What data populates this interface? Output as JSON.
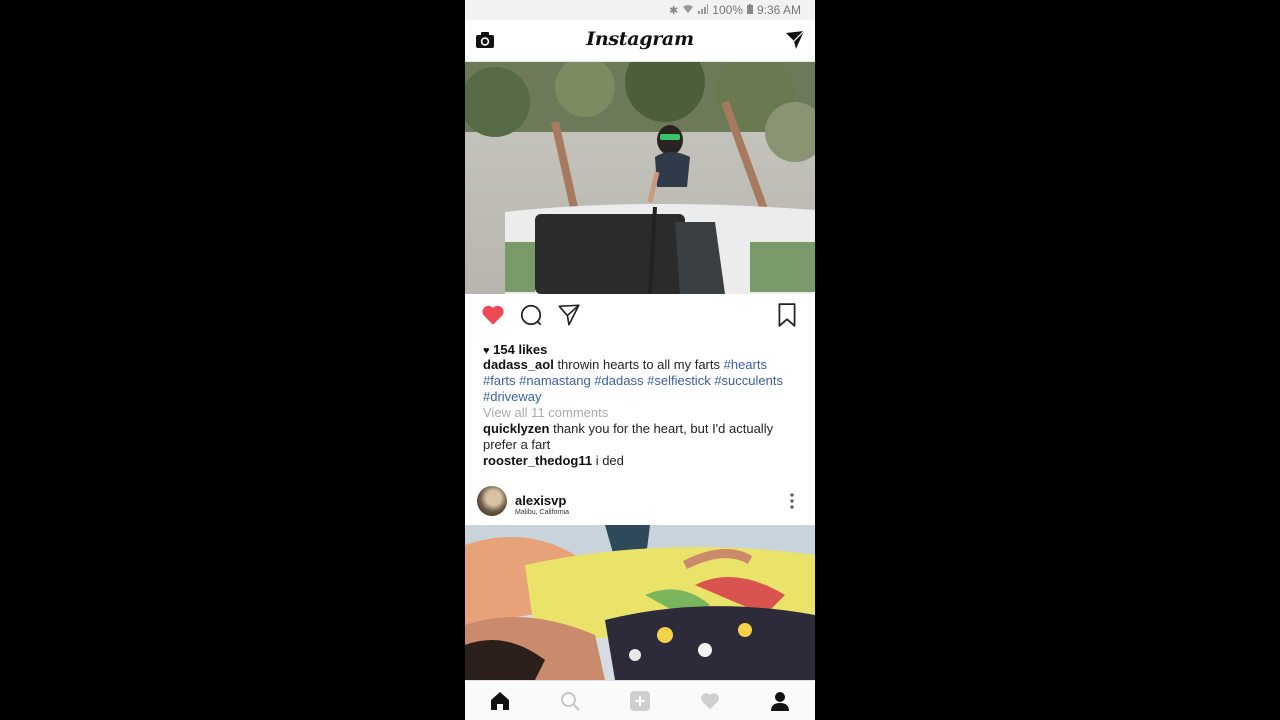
{
  "status_bar": {
    "battery": "100%",
    "time": "9:36 AM",
    "icons": [
      "bluetooth-icon",
      "wifi-icon",
      "signal-icon",
      "battery-icon"
    ]
  },
  "app_bar": {
    "title": "Instagram",
    "left_icon": "camera-icon",
    "right_icon": "direct-message-icon"
  },
  "post1": {
    "liked": true,
    "likes": "154 likes",
    "caption": {
      "username": "dadass_aol",
      "text": " throwin hearts to all my farts ",
      "hashtags": [
        "#hearts",
        "#farts",
        "#namastang",
        "#dadass",
        "#selfiestick",
        "#succulents",
        "#driveway"
      ]
    },
    "view_all_comments": "View all 11 comments",
    "comments": [
      {
        "username": "quicklyzen",
        "text": " thank you for the heart, but I'd actually prefer a fart"
      },
      {
        "username": "rooster_thedog11",
        "text": " i ded"
      }
    ]
  },
  "post2": {
    "username": "alexisvp",
    "location": "Malibu, California"
  },
  "bottom_nav": {
    "items": [
      "home-icon",
      "search-icon",
      "add-post-icon",
      "activity-heart-icon",
      "profile-icon"
    ],
    "active": "home-icon"
  },
  "colors": {
    "like_red": "#ed4956",
    "hashtag_blue": "#3a5fa0",
    "muted_gray": "#aaaaaa"
  }
}
